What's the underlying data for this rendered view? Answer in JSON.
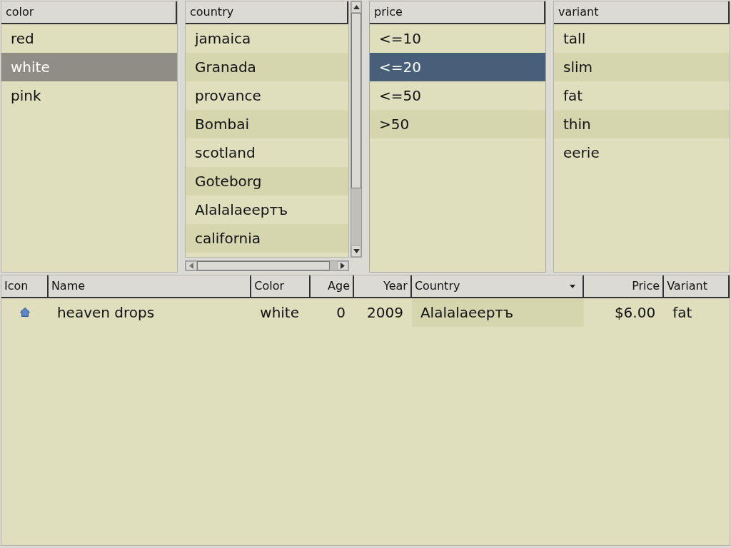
{
  "filters": [
    {
      "title": "color",
      "focused": false,
      "kind": "plain",
      "items": [
        {
          "label": "red",
          "selected": false
        },
        {
          "label": "white",
          "selected": true
        },
        {
          "label": "pink",
          "selected": false
        }
      ]
    },
    {
      "title": "country",
      "focused": false,
      "kind": "scrolled",
      "items": [
        {
          "label": "jamaica",
          "selected": false
        },
        {
          "label": "Granada",
          "selected": false
        },
        {
          "label": "provance",
          "selected": false
        },
        {
          "label": "Bombai",
          "selected": false
        },
        {
          "label": "scotland",
          "selected": false
        },
        {
          "label": "Goteborg",
          "selected": false
        },
        {
          "label": "Alalalaeертъ",
          "selected": false
        },
        {
          "label": "california",
          "selected": false
        }
      ]
    },
    {
      "title": "price",
      "focused": true,
      "kind": "plain",
      "items": [
        {
          "label": "<=10",
          "selected": false
        },
        {
          "label": "<=20",
          "selected": true
        },
        {
          "label": "<=50",
          "selected": false
        },
        {
          "label": ">50",
          "selected": false
        }
      ]
    },
    {
      "title": "variant",
      "focused": false,
      "kind": "plain",
      "items": [
        {
          "label": "tall",
          "selected": false
        },
        {
          "label": "slim",
          "selected": false
        },
        {
          "label": "fat",
          "selected": false
        },
        {
          "label": "thin",
          "selected": false
        },
        {
          "label": "eerie",
          "selected": false
        }
      ]
    }
  ],
  "table": {
    "columns": [
      {
        "label": "Icon",
        "kind": "icon",
        "sorted": false
      },
      {
        "label": "Name",
        "kind": "text",
        "sorted": false
      },
      {
        "label": "Color",
        "kind": "text",
        "sorted": false
      },
      {
        "label": "Age",
        "kind": "number",
        "sorted": false
      },
      {
        "label": "Year",
        "kind": "number",
        "sorted": false
      },
      {
        "label": "Country",
        "kind": "text",
        "sorted": true
      },
      {
        "label": "Price",
        "kind": "number",
        "sorted": false
      },
      {
        "label": "Variant",
        "kind": "text",
        "sorted": false
      }
    ],
    "rows": [
      {
        "cells": [
          "",
          "heaven drops",
          "white",
          "0",
          "2009",
          "Alalalaeертъ",
          "$6.00",
          "fat"
        ]
      }
    ]
  }
}
